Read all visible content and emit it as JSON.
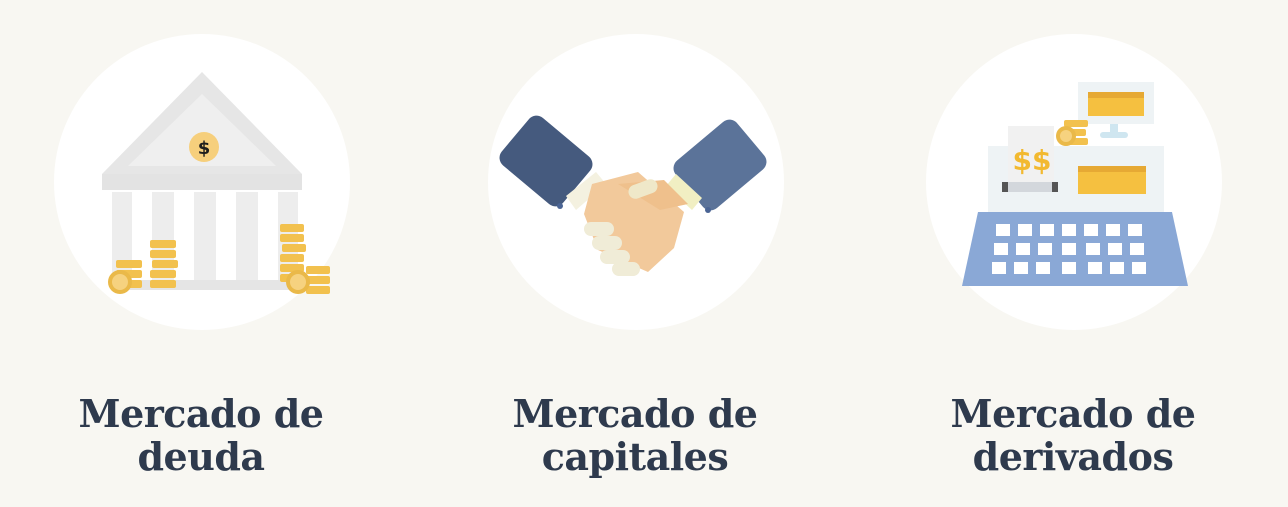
{
  "markets": [
    {
      "id": "deuda",
      "icon": "bank-building-icon",
      "title_line1": "Mercado de",
      "title_line2": "deuda",
      "icon_symbol": "$"
    },
    {
      "id": "capitales",
      "icon": "handshake-icon",
      "title_line1": "Mercado de",
      "title_line2": "capitales"
    },
    {
      "id": "derivados",
      "icon": "cash-register-icon",
      "title_line1": "Mercado de",
      "title_line2": "derivados",
      "icon_symbol": "$$"
    }
  ],
  "colors": {
    "background": "#f8f7f2",
    "circle": "#ffffff",
    "title": "#2e3a4d",
    "coin": "#f2c14e",
    "sleeve_dark": "#455a7e",
    "sleeve_light": "#5b7399",
    "skin": "#f2c99b",
    "register_blue": "#8aa8d6"
  }
}
